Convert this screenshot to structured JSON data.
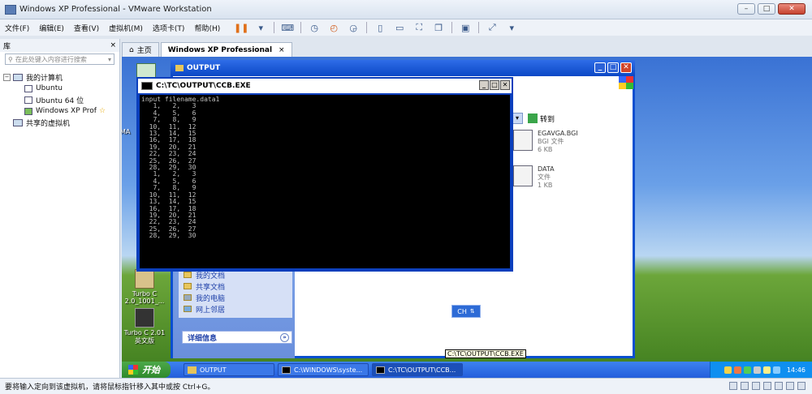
{
  "host": {
    "title": "Windows XP Professional - VMware Workstation",
    "window_controls": [
      "–",
      "□",
      "✕"
    ]
  },
  "menu": [
    "文件(F)",
    "编辑(E)",
    "查看(V)",
    "虚拟机(M)",
    "选项卡(T)",
    "帮助(H)"
  ],
  "toolbar_icons": [
    "pause-icon",
    "dropdown-icon",
    "send-keys-icon",
    "snapshot-icon",
    "revert-icon",
    "manage-snapshot-icon",
    "view-library-icon",
    "view-thumbnail-icon",
    "fullscreen-icon",
    "unity-icon",
    "console-icon",
    "stretch-icon"
  ],
  "library": {
    "title": "库",
    "close": "×",
    "search_placeholder": "在此处键入内容进行搜索",
    "tree": {
      "root": "我的计算机",
      "vms": [
        "Ubuntu",
        "Ubuntu 64 位",
        "Windows XP Prof"
      ],
      "shared": "共享的虚拟机"
    }
  },
  "tabs": [
    {
      "label": "主页"
    },
    {
      "label": "Windows XP Professional",
      "close": "×"
    }
  ],
  "guest": {
    "desktop_icons": [
      {
        "label": "Turbo C 2.0_1001_..."
      },
      {
        "label": "Turbo C 2.01 英文版"
      }
    ],
    "side_label": "MA",
    "explorer": {
      "title": "OUTPUT",
      "go_label": "转到",
      "tasks": [
        "我的文档",
        "共享文档",
        "我的电脑",
        "网上邻居"
      ],
      "details_label": "详细信息",
      "files": [
        {
          "name": "EGAVGA.BGI",
          "type": "BGI 文件",
          "size": "6 KB"
        },
        {
          "name": "DATA",
          "type": "文件",
          "size": "1 KB"
        }
      ]
    },
    "console": {
      "title": "C:\\TC\\OUTPUT\\CCB.EXE",
      "lines": [
        "input filename.data1",
        "   1,   2,   3",
        "   4,   5,   6",
        "   7,   8,   9",
        "  10,  11,  12",
        "  13,  14,  15",
        "  16,  17,  18",
        "  19,  20,  21",
        "  22,  23,  24",
        "  25,  26,  27",
        "  28,  29,  30",
        "   1,   2,   3",
        "   4,   5,   6",
        "   7,   8,   9",
        "  10,  11,  12",
        "  13,  14,  15",
        "  16,  17,  18",
        "  19,  20,  21",
        "  22,  23,  24",
        "  25,  26,  27",
        "  28,  29,  30"
      ]
    },
    "ime": "CH",
    "taskbar": {
      "start": "开始",
      "items": [
        "OUTPUT",
        "C:\\WINDOWS\\syste...",
        "C:\\TC\\OUTPUT\\CCB..."
      ],
      "clock": "14:46"
    },
    "tooltip": "C:\\TC\\OUTPUT\\CCB.EXE"
  },
  "status": "要将输入定向到该虚拟机，请将鼠标指针移入其中或按 Ctrl+G。"
}
